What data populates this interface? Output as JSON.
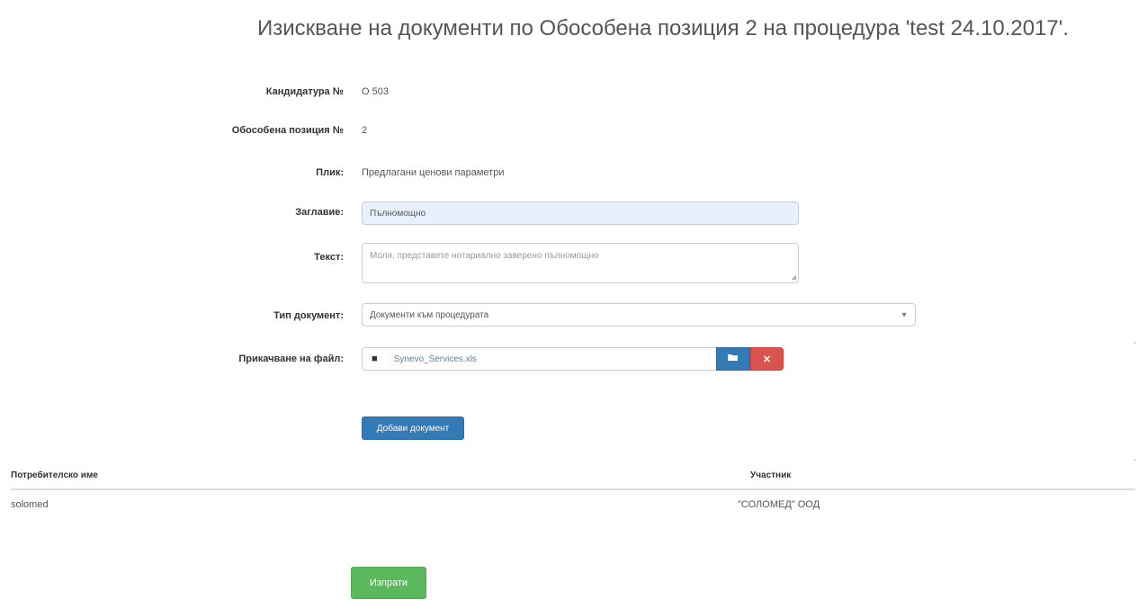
{
  "page_title": "Изискване на документи по Обособена позиция 2 на процедура 'test 24.10.2017'.",
  "form": {
    "candidacy": {
      "label": "Кандидатура №",
      "value": "О 503"
    },
    "lot": {
      "label": "Обособена позиция №",
      "value": "2"
    },
    "envelope": {
      "label": "Плик:",
      "value": "Предлагани ценови параметри"
    },
    "title": {
      "label": "Заглавие:",
      "value": "Пълномощно"
    },
    "text": {
      "label": "Текст:",
      "value": "Моля, представете нотариално заверено пълномощно"
    },
    "doc_type": {
      "label": "Тип документ:",
      "selected": "Документи към процедурата"
    },
    "attachment": {
      "label": "Прикачване на файл:",
      "file_name": "Synevo_Services.xls",
      "file_icon": "file-icon",
      "browse_icon": "folder-icon",
      "remove_icon": "close-icon"
    },
    "add_document_label": "Добави документ"
  },
  "table": {
    "headers": [
      "Потребителско име",
      "Участник"
    ],
    "rows": [
      [
        "solomed",
        "\"СОЛОМЕД\" ООД"
      ]
    ]
  },
  "send_label": "Изпрати",
  "colors": {
    "primary": "#337ab7",
    "danger": "#d9534f",
    "success": "#5cb85c",
    "autofill": "#e8f0fe"
  }
}
